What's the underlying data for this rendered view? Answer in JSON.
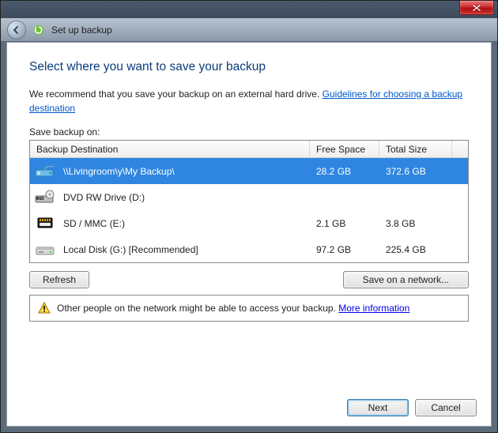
{
  "titlebar": {},
  "nav": {
    "title": "Set up backup"
  },
  "main": {
    "heading": "Select where you want to save your backup",
    "recommend_text": "We recommend that you save your backup on an external hard drive. ",
    "guidelines_link": "Guidelines for choosing a backup destination",
    "save_label": "Save backup on:",
    "columns": {
      "dest": "Backup Destination",
      "free": "Free Space",
      "total": "Total Size"
    },
    "rows": [
      {
        "icon": "network-drive",
        "name": "\\\\Livingroom\\y\\My Backup\\",
        "free": "28.2 GB",
        "total": "372.6 GB",
        "selected": true
      },
      {
        "icon": "dvd-drive",
        "name": "DVD RW Drive (D:)",
        "free": "",
        "total": "",
        "selected": false
      },
      {
        "icon": "sd-card",
        "name": "SD / MMC (E:)",
        "free": "2.1 GB",
        "total": "3.8 GB",
        "selected": false
      },
      {
        "icon": "local-disk",
        "name": "Local Disk (G:) [Recommended]",
        "free": "97.2 GB",
        "total": "225.4 GB",
        "selected": false
      }
    ],
    "refresh_label": "Refresh",
    "network_label": "Save on a network...",
    "warning_text": "Other people on the network might be able to access your backup. ",
    "warning_link": "More information"
  },
  "footer": {
    "next": "Next",
    "cancel": "Cancel"
  }
}
